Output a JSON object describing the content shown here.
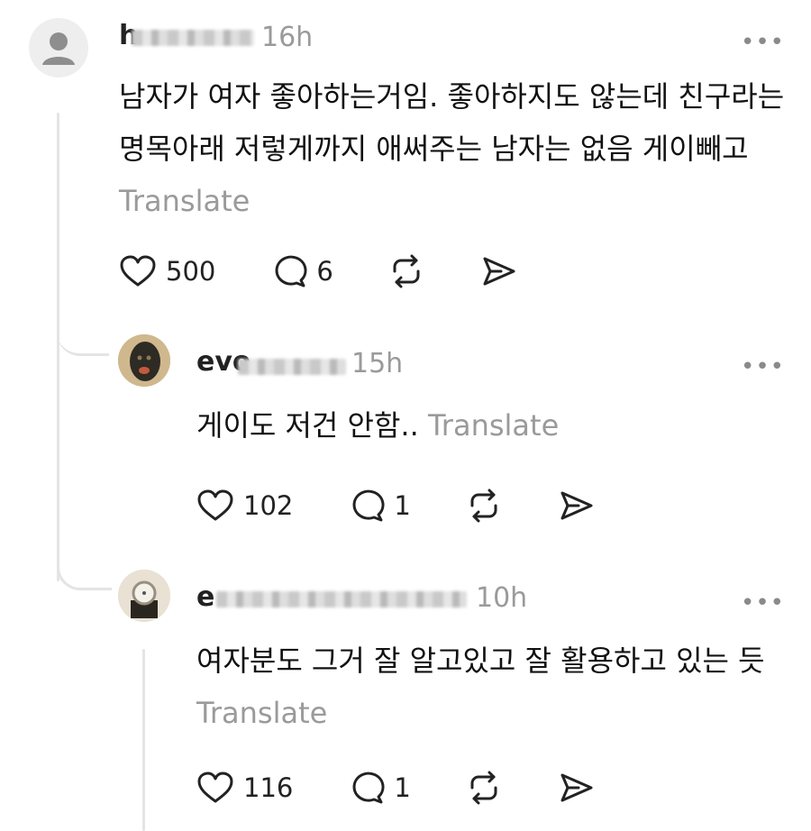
{
  "comments": [
    {
      "username": "h",
      "time": "16h",
      "more_label": "•••",
      "body": "남자가 여자 좋아하는거임. 좋아하지도 않는데 친구라는 명목아래 저렇게까지 애써주는 남자는 없음 게이빼고",
      "translate_label": "Translate",
      "likes": "500",
      "replies": "6"
    },
    {
      "username": "evo",
      "time": "15h",
      "more_label": "•••",
      "body": "게이도 저건 안함..",
      "translate_label": "Translate",
      "likes": "102",
      "replies": "1"
    },
    {
      "username": "e",
      "time": "10h",
      "more_label": "•••",
      "body": "여자분도 그거 잘 알고있고 잘 활용하고 있는 듯",
      "translate_label": "Translate",
      "likes": "116",
      "replies": "1"
    }
  ],
  "colors": {
    "text": "#111111",
    "muted": "#9a9a9a",
    "thread_line": "#e4e4e4"
  },
  "icons": [
    "person-avatar-icon",
    "heart-icon",
    "comment-icon",
    "repost-icon",
    "send-icon",
    "more-icon"
  ]
}
